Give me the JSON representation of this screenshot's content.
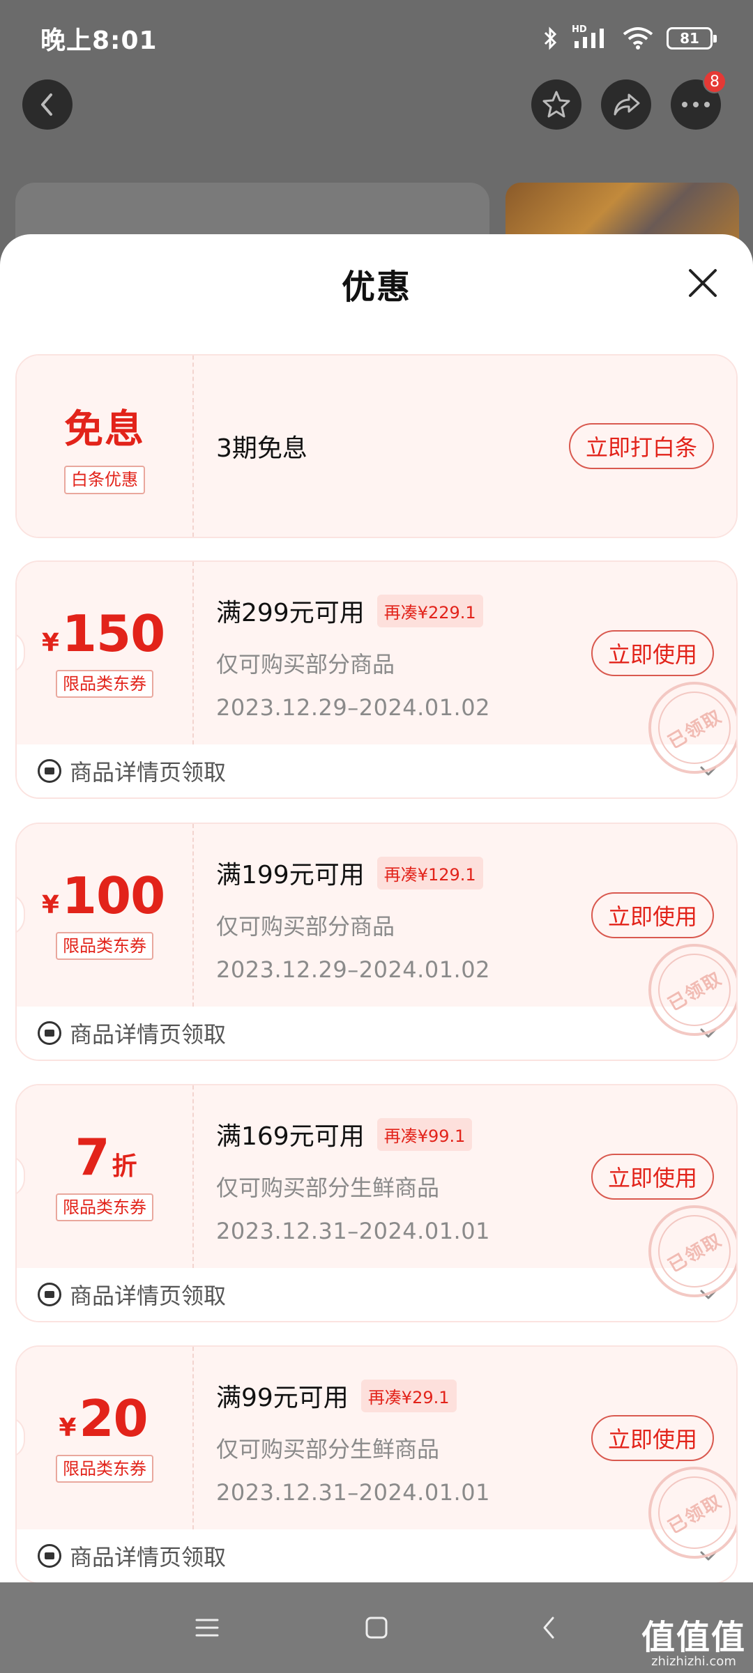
{
  "status_bar": {
    "time": "晚上8:01",
    "network": "HD",
    "battery": "81"
  },
  "overlay_nav": {
    "more_badge": "8"
  },
  "sheet": {
    "title": "优惠",
    "baitiao": {
      "title": "免息",
      "tag": "白条优惠",
      "desc": "3期免息",
      "button": "立即打白条"
    },
    "coupons": [
      {
        "yen": "¥",
        "amount": "150",
        "unit": "",
        "tag": "限品类东券",
        "condition": "满299元可用",
        "extra": "再凑¥229.1",
        "scope": "仅可购买部分商品",
        "date": "2023.12.29–2024.01.02",
        "button": "立即使用",
        "stamp": "已领取",
        "source": "商品详情页领取"
      },
      {
        "yen": "¥",
        "amount": "100",
        "unit": "",
        "tag": "限品类东券",
        "condition": "满199元可用",
        "extra": "再凑¥129.1",
        "scope": "仅可购买部分商品",
        "date": "2023.12.29–2024.01.02",
        "button": "立即使用",
        "stamp": "已领取",
        "source": "商品详情页领取"
      },
      {
        "yen": "",
        "amount": "7",
        "unit": "折",
        "tag": "限品类东券",
        "condition": "满169元可用",
        "extra": "再凑¥99.1",
        "scope": "仅可购买部分生鲜商品",
        "date": "2023.12.31–2024.01.01",
        "button": "立即使用",
        "stamp": "已领取",
        "source": "商品详情页领取"
      },
      {
        "yen": "¥",
        "amount": "20",
        "unit": "",
        "tag": "限品类东券",
        "condition": "满99元可用",
        "extra": "再凑¥29.1",
        "scope": "仅可购买部分生鲜商品",
        "date": "2023.12.31–2024.01.01",
        "button": "立即使用",
        "stamp": "已领取",
        "source": "商品详情页领取"
      }
    ]
  },
  "watermark": {
    "main": "值值值",
    "sub": "zhizhizhi.com"
  },
  "colors": {
    "accent": "#e2231a",
    "coupon_bg": "#fff4f2",
    "overlay": "#6b6b6b"
  }
}
